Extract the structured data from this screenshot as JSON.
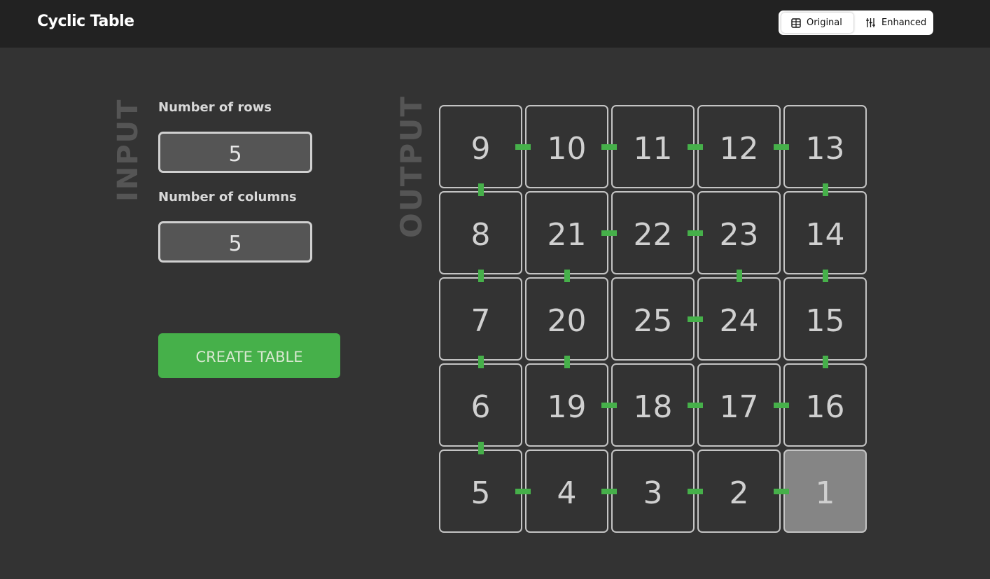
{
  "app": {
    "title": "Cyclic Table"
  },
  "view_toggle": {
    "original_label": "Original",
    "enhanced_label": "Enhanced",
    "active": "Original"
  },
  "input": {
    "section_label": "INPUT",
    "rows_label": "Number of rows",
    "rows_value": "5",
    "columns_label": "Number of columns",
    "columns_value": "5",
    "create_label": "CREATE TABLE"
  },
  "output": {
    "section_label": "OUTPUT",
    "rows": 5,
    "cols": 5,
    "grid": [
      [
        "9",
        "10",
        "11",
        "12",
        "13"
      ],
      [
        "8",
        "21",
        "22",
        "23",
        "14"
      ],
      [
        "7",
        "20",
        "25",
        "24",
        "15"
      ],
      [
        "6",
        "19",
        "18",
        "17",
        "16"
      ],
      [
        "5",
        "4",
        "3",
        "2",
        "1"
      ]
    ],
    "start_value": "1"
  },
  "colors": {
    "accent": "#46b04a",
    "start_cell": "#858585",
    "background": "#333333",
    "topbar": "#222222"
  }
}
